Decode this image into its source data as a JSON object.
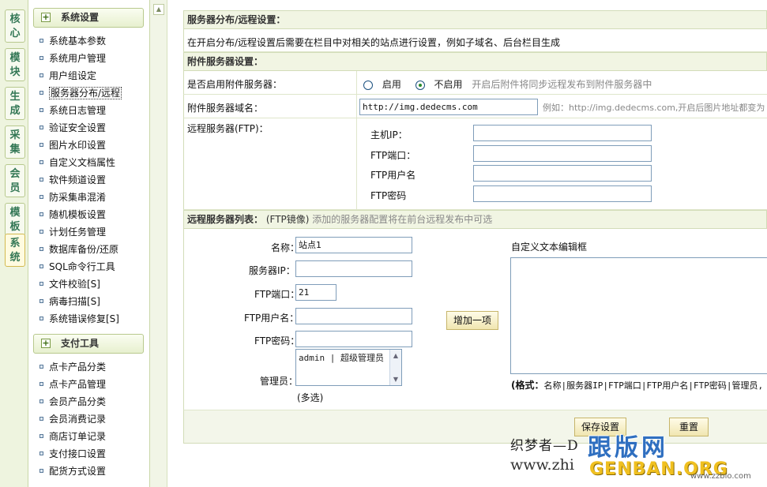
{
  "vtabs": [
    "核心",
    "模块",
    "生成",
    "采集",
    "会员",
    "模板",
    "系统"
  ],
  "sidebar": {
    "group1": "系统设置",
    "items1": [
      "系统基本参数",
      "系统用户管理",
      "用户组设定",
      "服务器分布/远程",
      "系统日志管理",
      "验证安全设置",
      "图片水印设置",
      "自定义文档属性",
      "软件频道设置",
      "防采集串混淆",
      "随机模板设置",
      "计划任务管理",
      "数据库备份/还原",
      "SQL命令行工具",
      "文件校验[S]",
      "病毒扫描[S]",
      "系统错误修复[S]"
    ],
    "group2": "支付工具",
    "items2": [
      "点卡产品分类",
      "点卡产品管理",
      "会员产品分类",
      "会员消费记录",
      "商店订单记录",
      "支付接口设置",
      "配货方式设置"
    ]
  },
  "main": {
    "title": "服务器分布/远程设置：",
    "intro": "在开启分布/远程设置后需要在栏目中对相关的站点进行设置，例如子域名、后台栏目生成",
    "attach_header": "附件服务器设置：",
    "enable_label": "是否启用附件服务器：",
    "radio_on": "启用",
    "radio_off": "不启用",
    "enable_hint": "开启后附件将同步远程发布到附件服务器中",
    "domain_label": "附件服务器域名：",
    "domain_value": "http://img.dedecms.com",
    "domain_hint": "例如：http://img.dedecms.com,开启后图片地址都变为",
    "ftp_label": "远程服务器(FTP)：",
    "ftp_host": "主机IP：",
    "ftp_port": "FTP端口：",
    "ftp_user": "FTP用户名",
    "ftp_pass": "FTP密码",
    "list_header": "远程服务器列表：",
    "list_sub": "(FTP镜像)",
    "list_hint": "添加的服务器配置将在前台远程发布中可选",
    "f_name": "名称：",
    "f_name_val": "站点1",
    "f_ip": "服务器IP：",
    "f_port": "FTP端口：",
    "f_port_val": "21",
    "f_user": "FTP用户名：",
    "f_pass": "FTP密码：",
    "f_admin": "管理员：",
    "admin_option": "admin | 超级管理员",
    "multi": "(多选)",
    "add_btn": "增加一项",
    "custom_label": "自定义文本编辑框",
    "format_bold": "(格式：",
    "format_rest": "名称|服务器IP|FTP端口|FTP用户名|FTP密码|管理员,",
    "save_btn": "保存设置",
    "reset_btn": "重置"
  },
  "watermark": {
    "line1": "织梦者—D",
    "line2": "www.zhi",
    "brand": "跟版网",
    "brand_en": "GENBAN.ORG",
    "small": "www.zzbio.com"
  }
}
